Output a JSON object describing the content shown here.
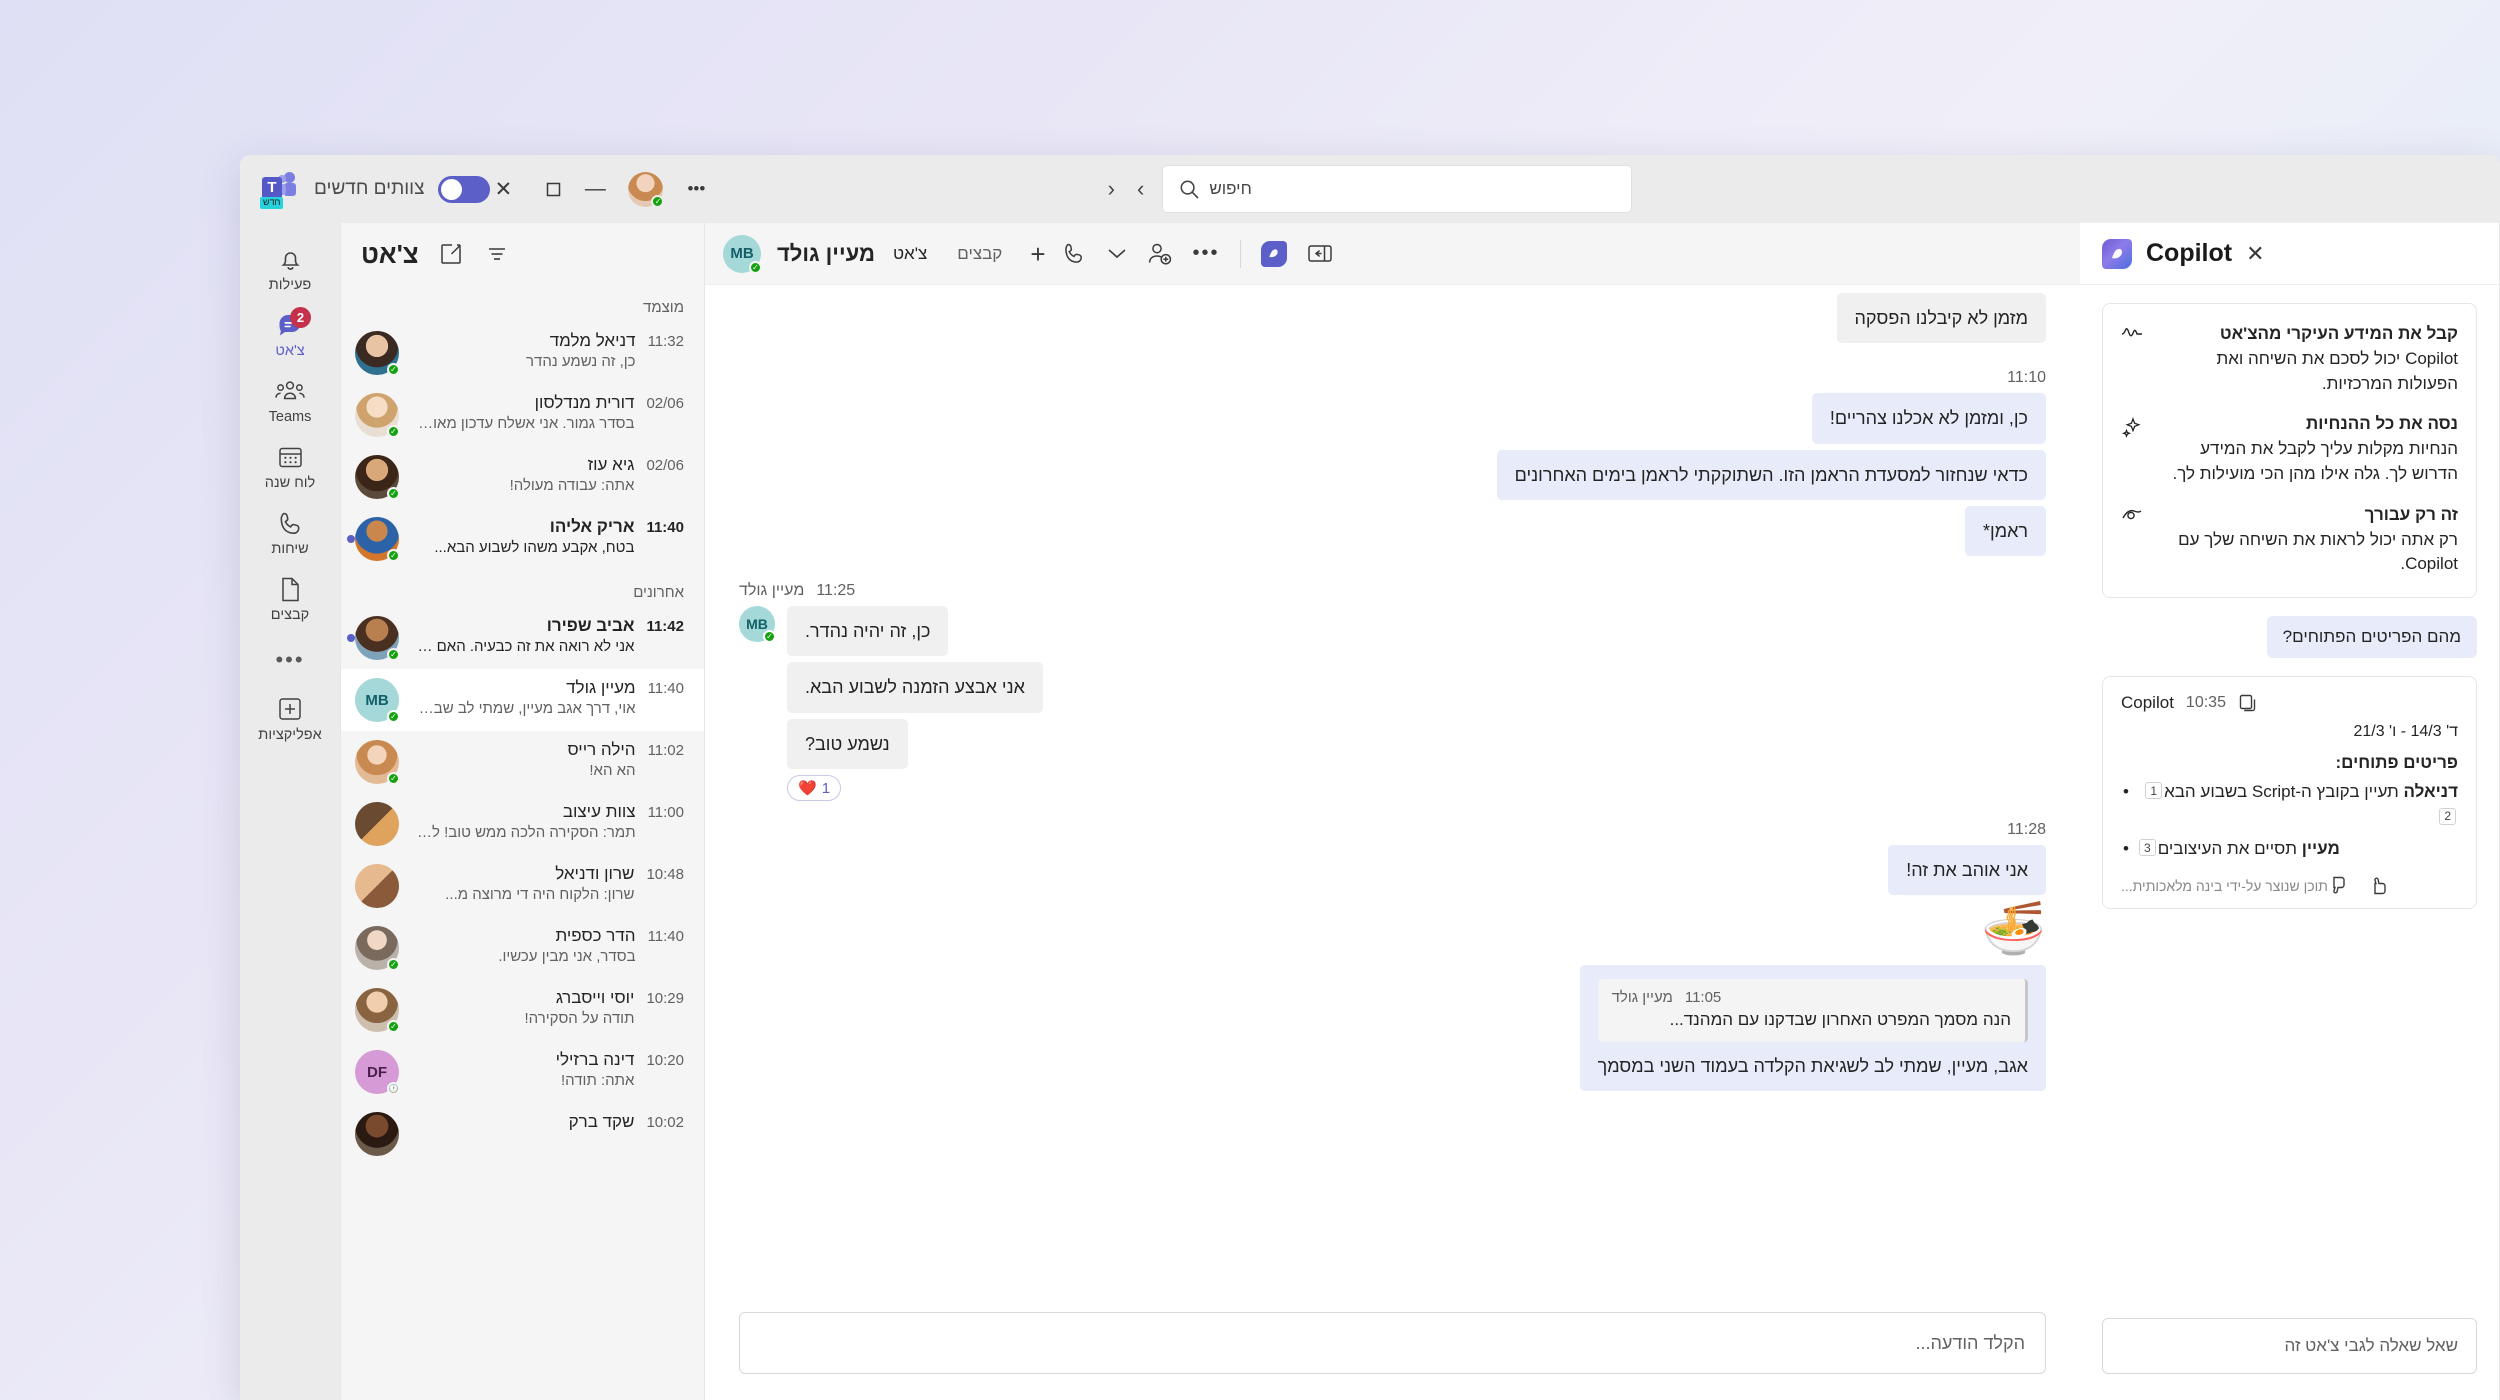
{
  "titlebar": {
    "window_controls": {
      "close": "✕",
      "maximize": "❐",
      "minimize": "—",
      "more": "•••"
    },
    "search": {
      "placeholder": "חיפוש",
      "icon": "search-icon",
      "value": ""
    },
    "nav": {
      "back": "‹",
      "forward": "›"
    },
    "new_teams_label": "צוותים חדשים",
    "teams_logo_letter": "T",
    "teams_logo_badge": "חדש",
    "toggle_on": true,
    "accent": "#5b5fc7"
  },
  "rail": {
    "items": [
      {
        "label": "פעילות",
        "icon": "bell-icon",
        "active": false,
        "badge": ""
      },
      {
        "label": "צ'אט",
        "icon": "chat-bubble-icon",
        "active": true,
        "badge": "2"
      },
      {
        "label": "Teams",
        "icon": "teams-people-icon",
        "active": false,
        "badge": ""
      },
      {
        "label": "לוח שנה",
        "icon": "calendar-icon",
        "active": false,
        "badge": ""
      },
      {
        "label": "שיחות",
        "icon": "phone-icon",
        "active": false,
        "badge": ""
      },
      {
        "label": "קבצים",
        "icon": "file-icon",
        "active": false,
        "badge": ""
      }
    ],
    "overflow": "•••",
    "apps": {
      "label": "אפליקציות",
      "icon": "plus-square-icon"
    }
  },
  "chat_list": {
    "title": "צ'אט",
    "icons": {
      "compose": "new-chat-icon",
      "filter": "filter-icon"
    },
    "sections": [
      {
        "label": "מוצמד",
        "rows": [
          {
            "name": "דניאל מלמד",
            "preview": "כן, זה נשמע נהדר",
            "time": "11:32",
            "unread": false,
            "selected": false,
            "dot": false,
            "presence": "available",
            "avatar_type": "photo",
            "avatar_color": "#7a4a2a"
          },
          {
            "name": "דורית מנדלסון",
            "preview": "בסדר גמור. אני אשלח עדכון מאוחר יותר.",
            "time": "02/06",
            "unread": false,
            "selected": false,
            "dot": false,
            "presence": "available",
            "avatar_type": "photo",
            "avatar_color": "#d9b48a"
          },
          {
            "name": "גיא עוז",
            "preview": "אתה: עבודה מעולה!",
            "time": "02/06",
            "unread": false,
            "selected": false,
            "dot": false,
            "presence": "available",
            "avatar_type": "photo",
            "avatar_color": "#5b3b2a"
          },
          {
            "name": "אריק אליהו",
            "preview": "בטח, אקבע משהו לשבוע הבא...",
            "time": "11:40",
            "unread": true,
            "selected": false,
            "dot": true,
            "presence": "available",
            "avatar_type": "photo",
            "avatar_color": "#c96a2a"
          }
        ]
      },
      {
        "label": "אחרונים",
        "rows": [
          {
            "name": "אביב שפירו",
            "preview": "אני לא רואה את זה כבעיה. האם אתה ...",
            "time": "11:42",
            "unread": true,
            "selected": false,
            "dot": true,
            "presence": "available",
            "avatar_type": "photo",
            "avatar_color": "#6b4630"
          },
          {
            "name": "מעיין גולד",
            "preview": "אוי, דרך אגב מעיין, שמתי לב שבמסמך...",
            "time": "11:40",
            "unread": false,
            "selected": true,
            "dot": false,
            "presence": "available",
            "avatar_type": "initials",
            "avatar_initials": "MB",
            "avatar_color": "#a5d8d8",
            "avatar_text_color": "#13606a"
          },
          {
            "name": "הילה רייס",
            "preview": "הא הא!",
            "time": "11:02",
            "unread": false,
            "selected": false,
            "dot": false,
            "presence": "available",
            "avatar_type": "photo",
            "avatar_color": "#c98a52"
          },
          {
            "name": "צוות עיצוב",
            "preview": "תמר: הסקירה הלכה ממש טוב! לא יכול ...",
            "time": "11:00",
            "unread": false,
            "selected": false,
            "dot": false,
            "presence": "none",
            "avatar_type": "group",
            "avatar_color": "#7a5a3a"
          },
          {
            "name": "שרון ודניאל",
            "preview": "שרון: הלקוח היה די מרוצה מ...",
            "time": "10:48",
            "unread": false,
            "selected": false,
            "dot": false,
            "presence": "none",
            "avatar_type": "group",
            "avatar_color": "#d2a57c"
          },
          {
            "name": "הדר כספית",
            "preview": "בסדר, אני מבין עכשיו.",
            "time": "11:40",
            "unread": false,
            "selected": false,
            "dot": false,
            "presence": "available",
            "avatar_type": "photo",
            "avatar_color": "#9a9a9a"
          },
          {
            "name": "יוסי וייסברג",
            "preview": "תודה על הסקירה!",
            "time": "10:29",
            "unread": false,
            "selected": false,
            "dot": false,
            "presence": "available",
            "avatar_type": "photo",
            "avatar_color": "#c0895e"
          },
          {
            "name": "דינה ברזילי",
            "preview": "אתה: תודה!",
            "time": "10:20",
            "unread": false,
            "selected": false,
            "dot": false,
            "presence": "away",
            "avatar_type": "initials",
            "avatar_initials": "DF",
            "avatar_color": "#d69ad6",
            "avatar_text_color": "#4b1f4b"
          },
          {
            "name": "שקד ברק",
            "preview": "",
            "time": "10:02",
            "unread": false,
            "selected": false,
            "dot": false,
            "presence": "none",
            "avatar_type": "photo",
            "avatar_color": "#4a3224"
          }
        ]
      }
    ]
  },
  "conversation": {
    "header": {
      "avatar_initials": "MB",
      "name": "מעיין גולד",
      "tabs": [
        {
          "label": "צ'אט",
          "active": true
        },
        {
          "label": "קבצים",
          "active": false
        }
      ],
      "add_tab": "+",
      "left_icons": [
        {
          "name": "call-icon",
          "glyph": "phone"
        },
        {
          "name": "chevron-down-icon",
          "glyph": "chevron"
        },
        {
          "name": "add-people-icon",
          "glyph": "person-add"
        },
        {
          "name": "more-options-icon",
          "glyph": "dots"
        },
        {
          "name": "copilot-icon",
          "glyph": "copilot"
        },
        {
          "name": "expand-panel-icon",
          "glyph": "panel"
        }
      ]
    },
    "messages": [
      {
        "id": "m0",
        "side": "incoming",
        "style": "grey",
        "text": "מזמן לא קיבלנו הפסקה",
        "time": "",
        "show_time": false
      },
      {
        "id": "m1",
        "side": "incoming",
        "style": "blue",
        "text": "כן, ומזמן לא אכלנו צהריים!",
        "time": "11:10",
        "show_time": true
      },
      {
        "id": "m2",
        "side": "incoming",
        "style": "blue",
        "text": "כדאי שנחזור למסעדת הראמן הזו. השתוקקתי לראמן בימים האחרונים",
        "time": "",
        "show_time": false
      },
      {
        "id": "m3",
        "side": "incoming",
        "style": "blue",
        "text": "ראמן*",
        "time": "",
        "show_time": false
      },
      {
        "id": "m4",
        "side": "outgoing",
        "style": "grey",
        "sender": "מעיין גולד",
        "time": "11:25",
        "lines": [
          "כן, זה יהיה נהדר.",
          "אני אבצע הזמנה לשבוע הבא.",
          "נשמע טוב?"
        ],
        "reaction": {
          "emoji": "❤️",
          "count": "1"
        }
      },
      {
        "id": "m5",
        "side": "incoming",
        "style": "blue",
        "text": "אני אוהב את זה!",
        "time": "11:28",
        "show_time": true
      },
      {
        "id": "m6",
        "side": "incoming",
        "style": "emoji",
        "emoji": "🍜"
      },
      {
        "id": "m7",
        "side": "incoming",
        "style": "quote",
        "quote_sender": "מעיין גולד",
        "quote_time": "11:05",
        "quote_text": "הנה מסמך המפרט האחרון שבדקנו עם המהנד...",
        "reply_text": "אגב, מעיין, שמתי לב לשגיאת הקלדה בעמוד השני במסמך"
      }
    ],
    "composer": {
      "placeholder": "הקלד הודעה..."
    }
  },
  "copilot": {
    "title": "Copilot",
    "logo": "copilot-icon",
    "close": "✕",
    "tips": [
      {
        "icon": "pulse-icon",
        "heading": "קבל את המידע העיקרי מהצ'אט",
        "body": "Copilot יכול לסכם את השיחה ואת הפעולות המרכזיות."
      },
      {
        "icon": "sparkle-icon",
        "heading": "נסה את כל ההנחיות",
        "body": "הנחיות מקלות עליך לקבל את המידע הדרוש לך. גלה אילו מהן הכי מועילות לך."
      },
      {
        "icon": "eye-icon",
        "heading": "זה רק עבורך",
        "body": "רק אתה יכול לראות את השיחה שלך עם Copilot."
      }
    ],
    "user_prompt": "מהם הפריטים הפתוחים?",
    "answer": {
      "who": "Copilot",
      "when": "10:35",
      "copy_icon": "copy-icon",
      "range": "ד' 14/3 - ו' 21/3",
      "heading": "פריטים פתוחים:",
      "items": [
        {
          "bold": "דניאלה",
          "rest": " תעיין בקובץ ה-Script בשבוע הבא",
          "citations": [
            "1",
            "2"
          ]
        },
        {
          "bold": "מעיין",
          "rest": " תסיים את העיצובים",
          "citations": [
            "3"
          ]
        }
      ],
      "disclaimer": "תוכן שנוצר על-ידי בינה מלאכותית...",
      "actions": [
        {
          "name": "thumbs-up-icon"
        },
        {
          "name": "thumbs-down-icon"
        }
      ]
    },
    "composer": {
      "placeholder": "שאל שאלה לגבי צ'אט זה"
    }
  }
}
